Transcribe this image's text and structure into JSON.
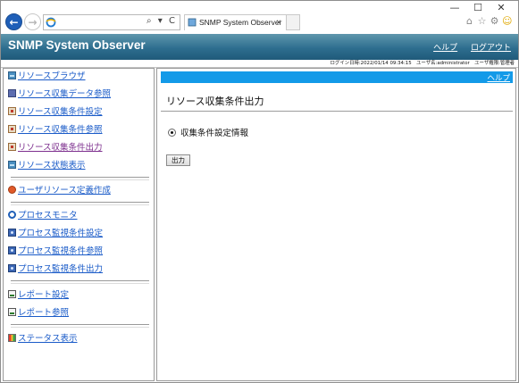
{
  "browser": {
    "tab_title": "SNMP System Observer",
    "tab_close": "×",
    "address_tools": "⌕ ▾ C",
    "window_controls": [
      "—",
      "☐",
      "✕"
    ],
    "icons": [
      "home-icon",
      "favorites-star-icon",
      "settings-gear-icon",
      "feedback-smiley-icon"
    ]
  },
  "app": {
    "title": "SNMP System Observer",
    "help_link": "ヘルプ",
    "logout_link": "ログアウト",
    "login_info": "ログイン日時:2022/01/14 09:34:15　ユーザ名:administrator　ユーザ権限:管理者"
  },
  "sidebar": {
    "groups": [
      [
        {
          "label": "リソースブラウザ",
          "icon": "resource-browser-icon"
        },
        {
          "label": "リソース収集データ参照",
          "icon": "resource-data-icon"
        },
        {
          "label": "リソース収集条件設定",
          "icon": "resource-settings-icon"
        },
        {
          "label": "リソース収集条件参照",
          "icon": "resource-view-icon"
        },
        {
          "label": "リソース収集条件出力",
          "icon": "resource-output-icon"
        },
        {
          "label": "リソース状態表示",
          "icon": "resource-status-icon"
        }
      ],
      [
        {
          "label": "ユーザリソース定義作成",
          "icon": "user-resource-icon"
        }
      ],
      [
        {
          "label": "プロセスモニタ",
          "icon": "process-monitor-icon"
        },
        {
          "label": "プロセス監視条件設定",
          "icon": "process-settings-icon"
        },
        {
          "label": "プロセス監視条件参照",
          "icon": "process-view-icon"
        },
        {
          "label": "プロセス監視条件出力",
          "icon": "process-output-icon"
        }
      ],
      [
        {
          "label": "レポート設定",
          "icon": "report-settings-icon"
        },
        {
          "label": "レポート参照",
          "icon": "report-view-icon"
        }
      ],
      [
        {
          "label": "ステータス表示",
          "icon": "status-display-icon"
        }
      ]
    ]
  },
  "main": {
    "help_link": "ヘルプ",
    "title": "リソース収集条件出力",
    "radio_label": "収集条件設定情報",
    "output_button": "出力"
  }
}
